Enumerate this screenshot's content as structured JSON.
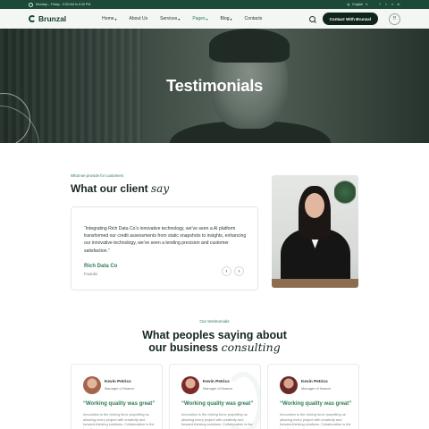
{
  "topbar": {
    "hours": "Monday – Friday : 9:30 AM to 6:30 PM",
    "language": "English",
    "social": [
      "f",
      "t",
      "v",
      "in"
    ]
  },
  "nav": {
    "brand": "Brunzal",
    "items": [
      {
        "label": "Home",
        "dropdown": true
      },
      {
        "label": "About Us",
        "dropdown": false
      },
      {
        "label": "Services",
        "dropdown": true
      },
      {
        "label": "Pages",
        "dropdown": true,
        "active": true
      },
      {
        "label": "Blog",
        "dropdown": true
      },
      {
        "label": "Contacts",
        "dropdown": false
      }
    ],
    "cta": "Contact With Brunzal"
  },
  "hero": {
    "title": "Testimonials"
  },
  "client": {
    "eyebrow": "What we provide for customers",
    "heading": "What our client",
    "heading_italic": "say",
    "quote": "“Integrating Rich Data Co’s innovative technology, we’ve seen a AI platform transformed our credit assessments from static snapshots to insights, enhancing our innovative technology, we’ve seen a lending precision and customer satisfaction.”",
    "author": "Rich Data Co",
    "role": "Founder"
  },
  "testimonials": {
    "eyebrow": "Our testimonials",
    "heading_line1": "What peoples saying about",
    "heading_line2": "our business",
    "heading_italic": "consulting",
    "cards": [
      {
        "name": "Kevin Petrics",
        "position": "Manager of finance",
        "headline": "“Working quality was great”",
        "body": "Innovation is the driving force propelling us allowing every project with creativity and forward-thinking solutions. Collaboration is the heartbeat, creating",
        "avatar_color": "#a5644c"
      },
      {
        "name": "Kevin Petrics",
        "position": "Manager of finance",
        "headline": "“Working quality was great”",
        "body": "Innovation is the driving force propelling us allowing every project with creativity and forward-thinking solutions. Collaboration is the heartbeat, creating",
        "avatar_color": "#7b2b2a"
      },
      {
        "name": "Kevin Petrics",
        "position": "Manager of finance",
        "headline": "“Working quality was great”",
        "body": "Innovation is the driving force propelling us allowing every project with creativity and forward-thinking solutions. Collaboration is the heartbeat, creating",
        "avatar_color": "#6a2a28"
      }
    ]
  },
  "colors": {
    "brand_dark": "#1d4a36",
    "accent": "#2f7b55"
  },
  "icons": [
    "clock-icon",
    "search-icon",
    "grid-menu-icon",
    "arrow-left-icon",
    "arrow-right-icon"
  ]
}
